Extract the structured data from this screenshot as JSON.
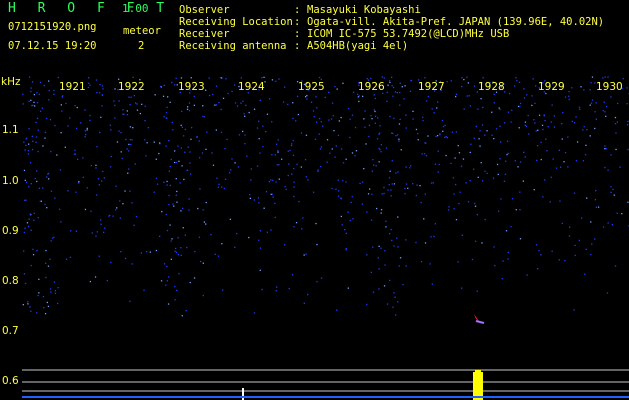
{
  "app": {
    "name": "H R O F F T",
    "version": "1.00"
  },
  "file": {
    "name": "0712151920.png",
    "timestamp": "07.12.15 19:20"
  },
  "meteor": {
    "label": "meteor",
    "count": "2"
  },
  "info": [
    {
      "key": "Observer",
      "colon": ":",
      "value": "Masayuki Kobayashi"
    },
    {
      "key": "Receiving Location",
      "colon": ":",
      "value": "Ogata-vill. Akita-Pref. JAPAN (139.96E, 40.02N)"
    },
    {
      "key": "Receiver",
      "colon": ":",
      "value": "ICOM IC-575 53.7492(@LCD)MHz USB"
    },
    {
      "key": "Receiving antenna",
      "colon": ":",
      "value": "A504HB(yagi 4el)"
    }
  ],
  "spectrogram": {
    "freq_unit": "kHz",
    "y_ticks": [
      "1.1",
      "1.0",
      "0.9",
      "0.8",
      "0.7",
      "0.6"
    ],
    "time_ticks": [
      "1921",
      "1922",
      "1923",
      "1924",
      "1925",
      "1926",
      "1927",
      "1928",
      "1929",
      "1930"
    ],
    "colors": {
      "background": "#000000",
      "noise": "#1a3cff",
      "noise_bright": "#6aa0ff",
      "meteor": "#ff3030",
      "level": "#ffff00",
      "grid": "#d0d0d0"
    }
  }
}
